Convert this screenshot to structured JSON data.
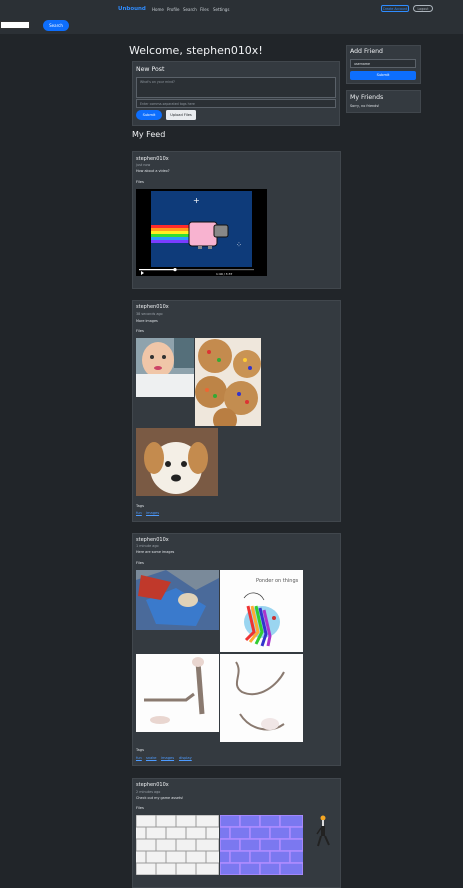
{
  "nav": {
    "brand": "Unbound",
    "links": [
      "Home",
      "Profile",
      "Search",
      "Files",
      "Settings"
    ],
    "primary_action": "Create Account",
    "secondary_action": "Logout"
  },
  "search": {
    "button": "Search",
    "value": ""
  },
  "welcome": "Welcome, stephen010x!",
  "new_post": {
    "title": "New Post",
    "body_placeholder": "What's on your mind?",
    "tags_placeholder": "Enter comma-separated tags here",
    "submit": "Submit",
    "upload": "Upload Files"
  },
  "feed_title": "My Feed",
  "add_friend": {
    "title": "Add Friend",
    "placeholder": "username",
    "submit": "Submit"
  },
  "friends": {
    "title": "My Friends",
    "empty": "Sorry, no friends!"
  },
  "posts": [
    {
      "author": "stephen010x",
      "time": "just now",
      "text": "How about a video?",
      "files_label": "Files",
      "video": {
        "time_label": "1:49 / 3:37"
      }
    },
    {
      "author": "stephen010x",
      "time": "38 seconds ago",
      "text": "More images",
      "files_label": "Files",
      "tags_label": "Tags",
      "tags": [
        "fun",
        "images"
      ]
    },
    {
      "author": "stephen010x",
      "time": "1 minute ago",
      "text": "Here are some images",
      "files_label": "Files",
      "tags_label": "Tags",
      "tags": [
        "fun",
        "snake",
        "images",
        "display"
      ],
      "image_text": "Ponder on things"
    },
    {
      "author": "stephen010x",
      "time": "2 minutes ago",
      "text": "Check out my game assets!",
      "files_label": "Files"
    }
  ],
  "colors": {
    "accent": "#0d6efd",
    "background": "#212529",
    "card": "#343a40"
  }
}
